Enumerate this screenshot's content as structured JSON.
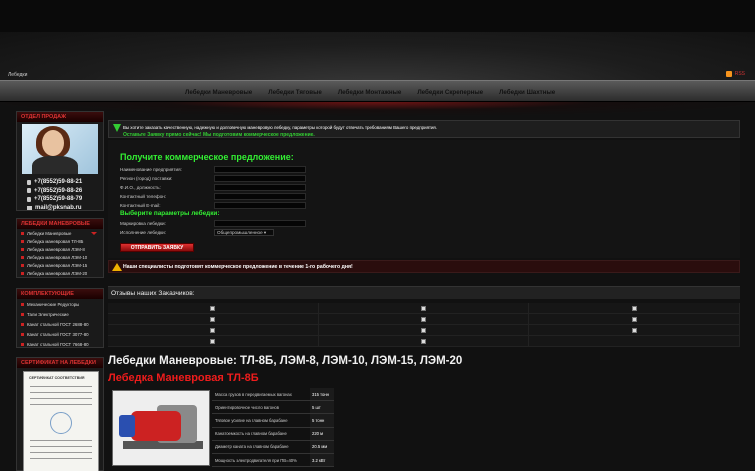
{
  "header": {
    "site_label": "Лебедки",
    "rss_label": "RSS"
  },
  "nav": {
    "items": [
      "Лебедки Маневровые",
      "Лебедки Тяговые",
      "Лебедки Монтажные",
      "Лебедки Скреперные",
      "Лебедки Шахтные"
    ]
  },
  "sidebar": {
    "sales": {
      "title": "ОТДЕЛ ПРОДАЖ",
      "phones": [
        "+7(8552)59-88-21",
        "+7(8552)59-88-26",
        "+7(8552)59-88-79"
      ],
      "email": "mail@pksnab.ru"
    },
    "winches": {
      "title": "ЛЕБЕДКИ МАНЕВРОВЫЕ",
      "items": [
        "Лебедки Маневровые",
        "Лебедка маневровая ТЛ-8Б",
        "Лебедка маневровая ЛЭМ-8",
        "Лебедка маневровая ЛЭМ-10",
        "Лебедка маневровая ЛЭМ-15",
        "Лебедка маневровая ЛЭМ-20"
      ]
    },
    "components": {
      "title": "КОМПЛЕКТУЮЩИЕ",
      "items": [
        "Механические Редукторы",
        "Тали Электрические",
        "Канат стальной ГОСТ 2688-80",
        "Канат стальной ГОСТ 3077-80",
        "Канат стальной ГОСТ 7668-80"
      ]
    },
    "certificate": {
      "title": "СЕРТИФИКАТ НА ЛЕБЕДКИ",
      "doc_header": "СЕРТИФИКАТ СООТВЕТСТВИЯ"
    }
  },
  "notice": {
    "line1": "Вы хотите заказать качественную, надежную и долговечную маневровую лебедку, параметры которой будут отвечать требованиям Вашего предприятия.",
    "line2": "Оставьте Заявку прямо сейчас! Мы подготовим коммерческое предложение."
  },
  "form": {
    "title": "Получите коммерческое предложение:",
    "fields": [
      "Наименование предприятия:",
      "Регион (город) поставки:",
      "Ф.И.О., должность:",
      "Контактный телефон:",
      "Контактный E-mail:"
    ],
    "params_title": "Выберите параметры лебедки:",
    "marking_label": "Маркировка лебедки:",
    "execution_label": "Исполнение лебедки:",
    "execution_value": "Общепромышленное",
    "submit": "ОТПРАВИТЬ ЗАЯВКУ"
  },
  "warning": {
    "text": "Наши специалисты подготовят коммерческое предложение в течение 1-го рабочего дня!"
  },
  "reviews": {
    "title": "Отзывы наших Заказчиков:"
  },
  "product": {
    "heading": "Лебедки Маневровые: ТЛ-8Б, ЛЭМ-8, ЛЭМ-10, ЛЭМ-15, ЛЭМ-20",
    "subheading": "Лебедка Маневровая ТЛ-8Б",
    "specs": [
      {
        "k": "Масса грузов в передвигаемых вагонах",
        "v": "315 тонн"
      },
      {
        "k": "Ориентировочное число вагонов",
        "v": "5 шт"
      },
      {
        "k": "Тяговое усилие на главном барабане",
        "v": "5 тонн"
      },
      {
        "k": "Канатоемкость на главном барабане",
        "v": "220 м"
      },
      {
        "k": "Диаметр каната на главном барабане",
        "v": "20.5 мм"
      },
      {
        "k": "Мощность электродвигателя при ПВ=40%",
        "v": "3.2 кВт"
      }
    ]
  },
  "colors": {
    "accent_red": "#ee1c1c",
    "accent_green": "#33ee33",
    "warning": "#f0b000"
  }
}
